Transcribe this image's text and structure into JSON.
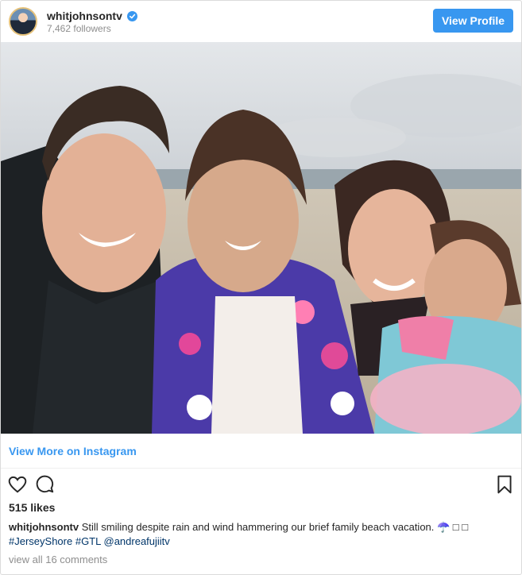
{
  "header": {
    "username": "whitjohnsontv",
    "followers": "7,462 followers",
    "view_profile_label": "View Profile",
    "verified_icon": "verified-badge"
  },
  "photo": {
    "description_icon": "family-beach-selfie-photo"
  },
  "view_more_label": "View More on Instagram",
  "actions": {
    "like_icon": "heart-icon",
    "comment_icon": "comment-icon",
    "save_icon": "bookmark-icon"
  },
  "likes": "515 likes",
  "caption": {
    "username": "whitjohnsontv",
    "text": "Still smiling despite rain and wind hammering our brief family beach vacation. ☂️ □ □",
    "hashtag1": "#JerseyShore",
    "hashtag2": "#GTL",
    "mention": "@andreafujiitv"
  },
  "comments_link": "view all 16 comments",
  "colors": {
    "accent": "#3897f0",
    "text": "#262626",
    "muted": "#8e8e8e",
    "link": "#003569"
  }
}
